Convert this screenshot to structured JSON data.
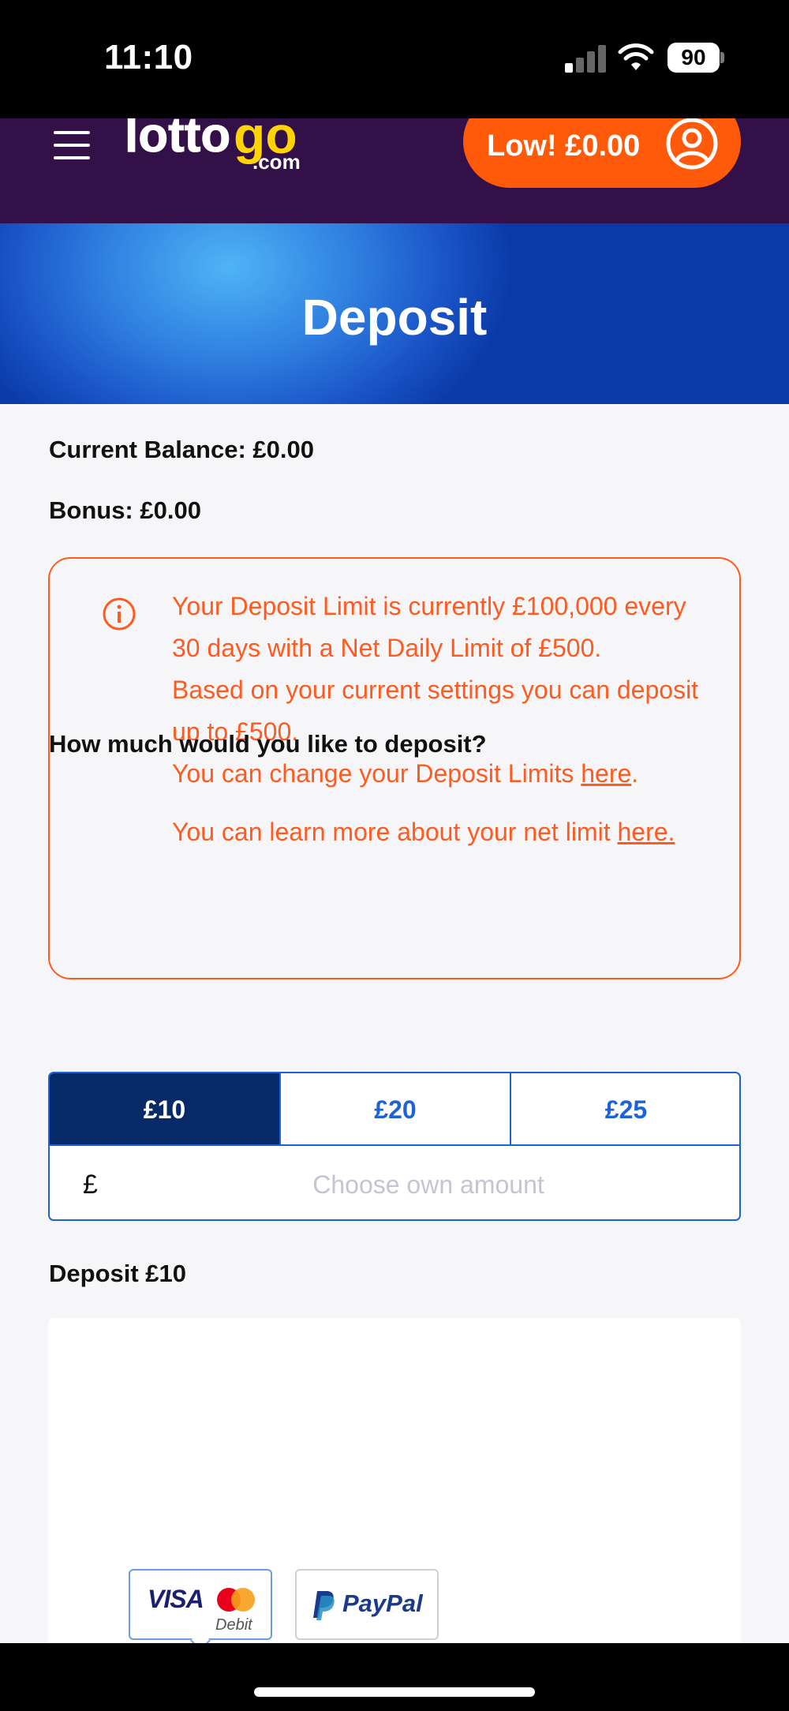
{
  "status_bar": {
    "time": "11:10",
    "battery": "90"
  },
  "header": {
    "logo": {
      "part1": "lotto",
      "part2": "go",
      "part3": ".com"
    },
    "balance_button": "Low! £0.00"
  },
  "hero": {
    "title": "Deposit"
  },
  "account": {
    "current_balance": "Current Balance: £0.00",
    "bonus": "Bonus: £0.00"
  },
  "notice": {
    "line1": "Your Deposit Limit is currently £100,000 every 30 days with a Net Daily Limit of £500.",
    "line2": "Based on your current settings you can deposit up to £500.",
    "line3_prefix": "You can change your Deposit Limits ",
    "line3_link": "here",
    "line3_suffix": ".",
    "line4_prefix": "You can learn more about your net limit ",
    "line4_link": "here."
  },
  "deposit_form": {
    "question": "How much would you like to deposit?",
    "amounts": [
      "£10",
      "£20",
      "£25"
    ],
    "selected_amount": "£10",
    "currency_symbol": "£",
    "own_amount_placeholder": "Choose own amount",
    "deposit_label": "Deposit £10"
  },
  "payment_methods": {
    "card": {
      "brand": "VISA",
      "type": "Debit"
    },
    "paypal": {
      "label": "PayPal"
    }
  },
  "colors": {
    "header_bg": "#331047",
    "accent_orange": "#ff5a0a",
    "primary_blue": "#1d63d8",
    "selected_navy": "#082a69",
    "logo_yellow": "#ffd400"
  }
}
